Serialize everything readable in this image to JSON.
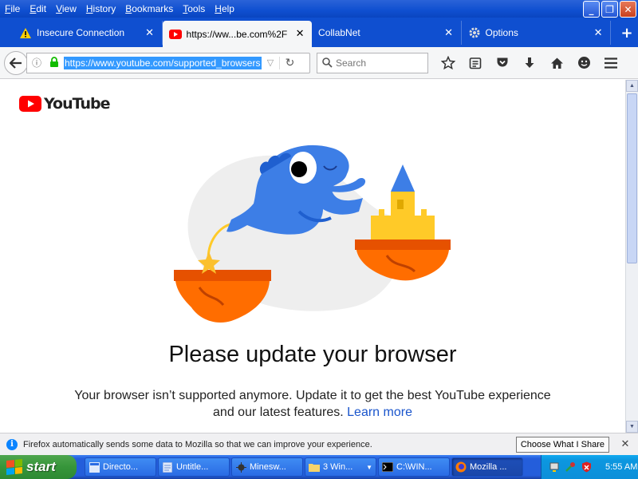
{
  "menus": [
    "File",
    "Edit",
    "View",
    "History",
    "Bookmarks",
    "Tools",
    "Help"
  ],
  "window_controls": {
    "minimize": "_",
    "maximize": "❐",
    "close": "✕"
  },
  "tabs": [
    {
      "label": "Insecure Connection",
      "icon": "warning-icon",
      "active": false
    },
    {
      "label": "https://ww...be.com%2F",
      "icon": "youtube-icon",
      "active": true
    },
    {
      "label": "CollabNet",
      "icon": "",
      "active": false
    },
    {
      "label": "Options",
      "icon": "gear-icon",
      "active": false
    }
  ],
  "tab_close": "✕",
  "new_tab": "+",
  "url": "https://www.youtube.com/supported_browsers?ne",
  "search_placeholder": "Search",
  "page": {
    "logo_text": "YouTube",
    "heading": "Please update your browser",
    "body": "Your browser isn’t supported anymore. Update it to get the best YouTube experience and our latest features.",
    "link": "Learn more"
  },
  "notification": {
    "text": "Firefox automatically sends some data to Mozilla so that we can improve your experience.",
    "button": "Choose What I Share",
    "close": "✕"
  },
  "taskbar": {
    "start": "start",
    "tasks": [
      {
        "label": "Directo...",
        "icon": "ie-icon",
        "active": false
      },
      {
        "label": "Untitle...",
        "icon": "notepad-icon",
        "active": false
      },
      {
        "label": "Minesw...",
        "icon": "minesweeper-icon",
        "active": false
      },
      {
        "label": "3 Win...",
        "icon": "folder-icon",
        "active": false
      },
      {
        "label": "C:\\WIN...",
        "icon": "cmd-icon",
        "active": false
      },
      {
        "label": "Mozilla ...",
        "icon": "firefox-icon",
        "active": true
      }
    ],
    "clock": "5:55 AM"
  },
  "colors": {
    "accent": "#0f4fd0",
    "youtube_red": "#ff0000",
    "link": "#1a55cc"
  }
}
